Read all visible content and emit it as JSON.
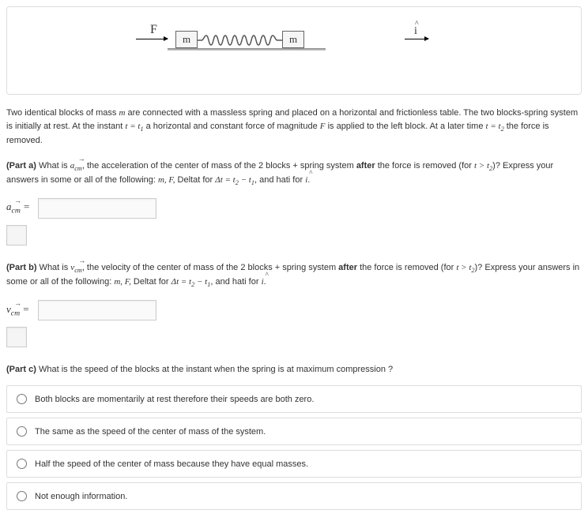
{
  "diagram": {
    "force_label": "F",
    "block_label": "m",
    "ihat_label": "i"
  },
  "intro": {
    "p1a": "Two identical blocks of mass ",
    "m": "m",
    "p1b": " are connected with a massless spring and placed on a horizontal and frictionless table. The two blocks-spring system is initially at rest. At the instant ",
    "eq1": "t = t",
    "sub1": "1",
    "p1c": " a horizontal and constant force of magnitude ",
    "F": "F",
    "p1d": " is applied to the left block. At a later time ",
    "eq2": "t = t",
    "sub2": "2",
    "p1e": " the force is removed."
  },
  "partA": {
    "label": "(Part a)",
    "t1": " What is ",
    "sym": "a",
    "sub": "cm",
    "t2": ", the acceleration of the center of mass of the 2 blocks + spring system ",
    "after": "after",
    "t3": " the force is removed (for ",
    "cond": "t > t",
    "condsub": "2",
    "t4": ")? Express your answers in some or all of the following: ",
    "vars": "m, F,",
    "t5": " Deltat for ",
    "dt": "Δt = t",
    "dtsub2": "2",
    "dtmid": " − t",
    "dtsub1": "1",
    "t6": ", and hati for ",
    "ihat": "i",
    "t7": ".",
    "ans_sym": "a",
    "ans_sub": "cm",
    "eq": " ="
  },
  "partB": {
    "label": "(Part b)",
    "t1": " What is ",
    "sym": "v",
    "sub": "cm",
    "t2": ", the velocity of the center of mass of the 2 blocks + spring system ",
    "after": "after",
    "t3": " the force is removed (for ",
    "cond": "t > t",
    "condsub": "2",
    "t4": ")? Express your answers in some or all of the following: ",
    "vars": "m, F,",
    "t5": " Deltat for ",
    "dt": "Δt = t",
    "dtsub2": "2",
    "dtmid": " − t",
    "dtsub1": "1",
    "t6": ", and hati for ",
    "ihat": "i",
    "t7": ".",
    "ans_sym": "v",
    "ans_sub": "cm",
    "eq": " ="
  },
  "partC": {
    "label": "(Part c)",
    "text": " What is the speed of the blocks at the instant when the spring is at maximum compression ?",
    "options": [
      "Both blocks are momentarily at rest therefore their speeds are both zero.",
      "The same as the speed of the center of mass of the system.",
      "Half the speed of the center of mass because they have equal masses.",
      "Not enough information."
    ]
  }
}
